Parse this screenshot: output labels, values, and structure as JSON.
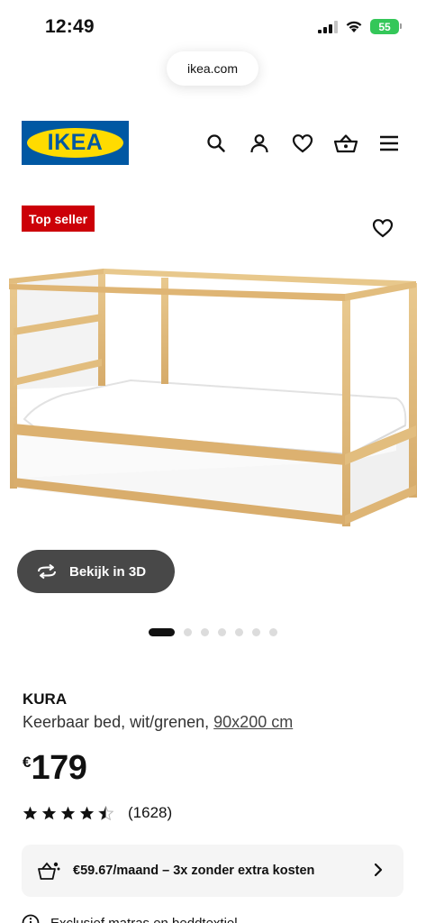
{
  "status_bar": {
    "time": "12:49",
    "battery": "55"
  },
  "browser": {
    "url": "ikea.com"
  },
  "header": {
    "logo_text": "IKEA",
    "icons": [
      "search-icon",
      "account-icon",
      "heart-icon",
      "basket-icon",
      "menu-icon"
    ]
  },
  "badge": {
    "label": "Top seller"
  },
  "gallery": {
    "view3d_label": "Bekijk in 3D",
    "slide_count": 7,
    "active_slide": 1
  },
  "product": {
    "name": "KURA",
    "description": "Keerbaar bed, wit/grenen,",
    "size": "90x200 cm",
    "currency": "€",
    "price": "179"
  },
  "rating": {
    "stars": 4.5,
    "count": "(1628)"
  },
  "financing": {
    "text": "€59.67/maand – 3x zonder extra kosten"
  },
  "extra_info": {
    "text": "Exclusief matras en beddtextiel"
  },
  "colors": {
    "ikea_blue": "#0058a3",
    "ikea_yellow": "#ffdb00",
    "badge_red": "#cc0008",
    "battery_green": "#34c759"
  }
}
